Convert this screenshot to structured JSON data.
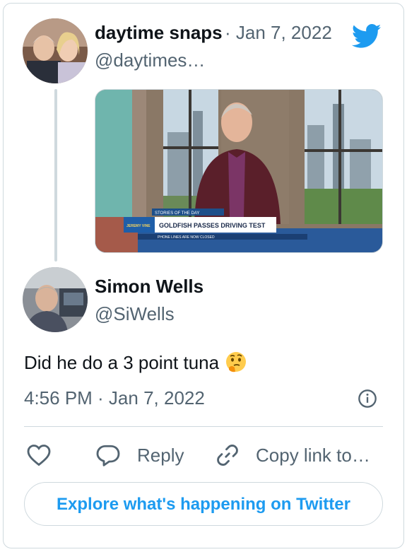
{
  "parent_tweet": {
    "author_name": "daytime snaps",
    "date": "· Jan 7, 2022",
    "handle": "@daytimes…",
    "avatar": "avatar-photo",
    "media": {
      "alt": "Presenter in TV studio",
      "banner_top": "STORIES OF THE DAY",
      "banner_logo": "JEREMY VINE",
      "banner_headline": "GOLDFISH PASSES DRIVING TEST",
      "banner_ticker": "PHONE LINES ARE NOW CLOSED"
    }
  },
  "reply_tweet": {
    "author_name": "Simon Wells",
    "handle": "@SiWells",
    "avatar": "avatar-photo",
    "text": "Did he do a 3 point tuna",
    "emoji": "thinking-face-emoji",
    "timestamp": "4:56 PM · Jan 7, 2022"
  },
  "actions": {
    "like_icon": "heart-icon",
    "reply_icon": "speech-bubble-icon",
    "reply_label": "Reply",
    "copy_icon": "link-icon",
    "copy_label": "Copy link to…"
  },
  "explore_label": "Explore what's happening on Twitter",
  "colors": {
    "accent": "#1d9bf0",
    "text": "#0f1419",
    "secondary_text": "#536471",
    "border": "#cfd9de"
  }
}
